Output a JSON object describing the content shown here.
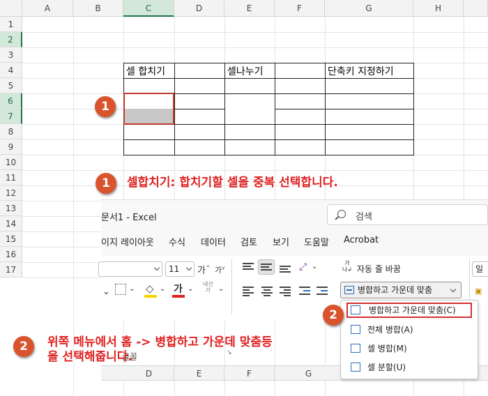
{
  "sheet": {
    "columns": [
      "A",
      "B",
      "C",
      "D",
      "E",
      "F",
      "G",
      "H"
    ],
    "rows": [
      "1",
      "2",
      "3",
      "4",
      "5",
      "6",
      "7",
      "8",
      "9",
      "10",
      "11",
      "12",
      "13",
      "14",
      "15",
      "16",
      "17"
    ],
    "selected_column": "C",
    "selected_rows": [
      "2",
      "6",
      "7"
    ]
  },
  "table": {
    "headers": [
      "셀 합치기",
      "",
      "셀나누기",
      "",
      "단축키 지정하기"
    ]
  },
  "annotations": {
    "badge1": "1",
    "badge2": "2",
    "step1": "셀합치기: 합치기할 셀을 중복 선택합니다.",
    "step2_line1": "위쪽 메뉴에서 홈 -> 병합하고 가운데 맞춤등",
    "step2_line2": "을 선택해줍니다."
  },
  "excel": {
    "title": "문서1  -  Excel",
    "search_placeholder": "검색",
    "tabs": [
      "이지 레이아웃",
      "수식",
      "데이터",
      "검토",
      "보기",
      "도움말",
      "Acrobat"
    ],
    "font_size": "11",
    "wrap_text": "자동 줄 바꿈",
    "merge_button": "병합하고 가운데 맞춤",
    "group_label": "글꼴",
    "font_color_glyph": "가",
    "grow_font": "가",
    "shrink_font": "가",
    "partial_right": "일",
    "merge_menu": [
      "병합하고 가운데 맞춤(C)",
      "전체 병합(A)",
      "셀 병합(M)",
      "셀 분할(U)"
    ]
  },
  "lower_columns": [
    "D",
    "E",
    "F",
    "G"
  ],
  "colors": {
    "accent_green": "#217346",
    "annotation_red": "#e02020",
    "badge_orange": "#d9532c"
  }
}
